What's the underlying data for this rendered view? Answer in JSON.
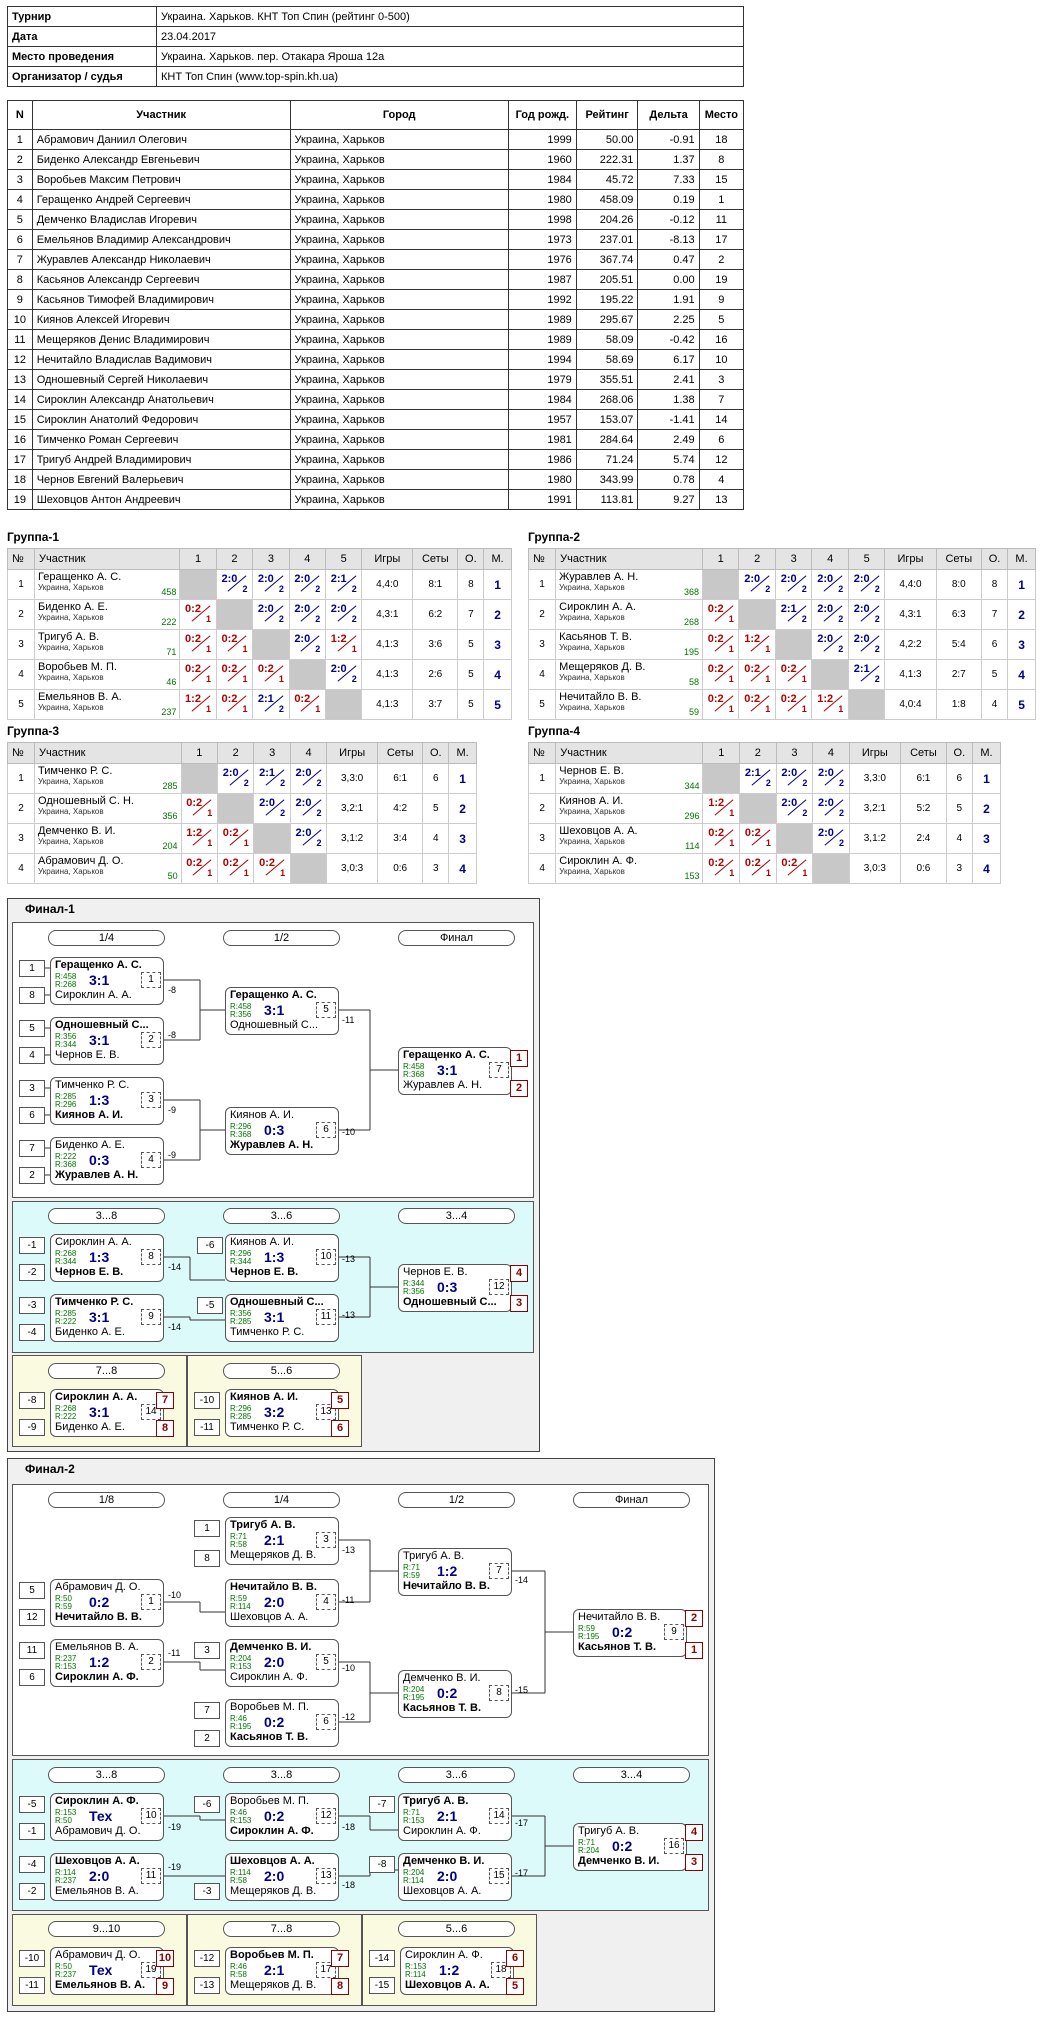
{
  "info": [
    {
      "k": "Турнир",
      "v": "Украина. Харьков. КНТ Топ Спин (рейтинг 0-500)"
    },
    {
      "k": "Дата",
      "v": "23.04.2017"
    },
    {
      "k": "Место проведения",
      "v": "Украина. Харьков. пер. Отакара Яроша 12а"
    },
    {
      "k": "Организатор / судья",
      "v": "КНТ Топ Спин (www.top-spin.kh.ua)"
    }
  ],
  "players_header": [
    "N",
    "Участник",
    "Город",
    "Год рожд.",
    "Рейтинг",
    "Дельта",
    "Место"
  ],
  "players": [
    [
      "1",
      "Абрамович Даниил Олегович",
      "Украина, Харьков",
      "1999",
      "50.00",
      "-0.91",
      "18"
    ],
    [
      "2",
      "Биденко Александр Евгеньевич",
      "Украина, Харьков",
      "1960",
      "222.31",
      "1.37",
      "8"
    ],
    [
      "3",
      "Воробьев Максим Петрович",
      "Украина, Харьков",
      "1984",
      "45.72",
      "7.33",
      "15"
    ],
    [
      "4",
      "Геращенко Андрей Сергеевич",
      "Украина, Харьков",
      "1980",
      "458.09",
      "0.19",
      "1"
    ],
    [
      "5",
      "Демченко Владислав Игоревич",
      "Украина, Харьков",
      "1998",
      "204.26",
      "-0.12",
      "11"
    ],
    [
      "6",
      "Емельянов Владимир Александрович",
      "Украина, Харьков",
      "1973",
      "237.01",
      "-8.13",
      "17"
    ],
    [
      "7",
      "Журавлев Александр Николаевич",
      "Украина, Харьков",
      "1976",
      "367.74",
      "0.47",
      "2"
    ],
    [
      "8",
      "Касьянов Александр Сергеевич",
      "Украина, Харьков",
      "1987",
      "205.51",
      "0.00",
      "19"
    ],
    [
      "9",
      "Касьянов Тимофей Владимирович",
      "Украина, Харьков",
      "1992",
      "195.22",
      "1.91",
      "9"
    ],
    [
      "10",
      "Киянов Алексей Игоревич",
      "Украина, Харьков",
      "1989",
      "295.67",
      "2.25",
      "5"
    ],
    [
      "11",
      "Мещеряков Денис Владимирович",
      "Украина, Харьков",
      "1989",
      "58.09",
      "-0.42",
      "16"
    ],
    [
      "12",
      "Нечитайло Владислав Вадимович",
      "Украина, Харьков",
      "1994",
      "58.69",
      "6.17",
      "10"
    ],
    [
      "13",
      "Одношевный Сергей Николаевич",
      "Украина, Харьков",
      "1979",
      "355.51",
      "2.41",
      "3"
    ],
    [
      "14",
      "Сироклин Александр Анатольевич",
      "Украина, Харьков",
      "1984",
      "268.06",
      "1.38",
      "7"
    ],
    [
      "15",
      "Сироклин Анатолий Федорович",
      "Украина, Харьков",
      "1957",
      "153.07",
      "-1.41",
      "14"
    ],
    [
      "16",
      "Тимченко Роман Сергеевич",
      "Украина, Харьков",
      "1981",
      "284.64",
      "2.49",
      "6"
    ],
    [
      "17",
      "Тригуб Андрей Владимирович",
      "Украина, Харьков",
      "1986",
      "71.24",
      "5.74",
      "12"
    ],
    [
      "18",
      "Чернов Евгений Валерьевич",
      "Украина, Харьков",
      "1980",
      "343.99",
      "0.78",
      "4"
    ],
    [
      "19",
      "Шеховцов Антон Андреевич",
      "Украина, Харьков",
      "1991",
      "113.81",
      "9.27",
      "13"
    ]
  ],
  "group_cols": {
    "no": "№",
    "player": "Участник",
    "games": "Игры",
    "sets": "Сеты",
    "pts": "О.",
    "place": "М."
  },
  "groups": [
    {
      "title": "Группа-1",
      "size": 5,
      "rows": [
        {
          "no": "1",
          "name": "Геращенко А. С.",
          "city": "Украина, Харьков",
          "rating": "458",
          "res": [
            "",
            "2:0/2",
            "2:0/2",
            "2:0/2",
            "2:1/2"
          ],
          "games": "4,4:0",
          "sets": "8:1",
          "pts": "8",
          "place": "1"
        },
        {
          "no": "2",
          "name": "Биденко А. Е.",
          "city": "Украина, Харьков",
          "rating": "222",
          "res": [
            "0:2/1",
            "",
            "2:0/2",
            "2:0/2",
            "2:0/2"
          ],
          "games": "4,3:1",
          "sets": "6:2",
          "pts": "7",
          "place": "2"
        },
        {
          "no": "3",
          "name": "Тригуб А. В.",
          "city": "Украина, Харьков",
          "rating": "71",
          "res": [
            "0:2/1",
            "0:2/1",
            "",
            "2:0/2",
            "1:2/1"
          ],
          "games": "4,1:3",
          "sets": "3:6",
          "pts": "5",
          "place": "3"
        },
        {
          "no": "4",
          "name": "Воробьев М. П.",
          "city": "Украина, Харьков",
          "rating": "46",
          "res": [
            "0:2/1",
            "0:2/1",
            "0:2/1",
            "",
            "2:0/2"
          ],
          "games": "4,1:3",
          "sets": "2:6",
          "pts": "5",
          "place": "4"
        },
        {
          "no": "5",
          "name": "Емельянов В. А.",
          "city": "Украина, Харьков",
          "rating": "237",
          "res": [
            "1:2/1",
            "0:2/1",
            "2:1/2",
            "0:2/1",
            ""
          ],
          "games": "4,1:3",
          "sets": "3:7",
          "pts": "5",
          "place": "5"
        }
      ]
    },
    {
      "title": "Группа-2",
      "size": 5,
      "rows": [
        {
          "no": "1",
          "name": "Журавлев А. Н.",
          "city": "Украина, Харьков",
          "rating": "368",
          "res": [
            "",
            "2:0/2",
            "2:0/2",
            "2:0/2",
            "2:0/2"
          ],
          "games": "4,4:0",
          "sets": "8:0",
          "pts": "8",
          "place": "1"
        },
        {
          "no": "2",
          "name": "Сироклин А. А.",
          "city": "Украина, Харьков",
          "rating": "268",
          "res": [
            "0:2/1",
            "",
            "2:1/2",
            "2:0/2",
            "2:0/2"
          ],
          "games": "4,3:1",
          "sets": "6:3",
          "pts": "7",
          "place": "2"
        },
        {
          "no": "3",
          "name": "Касьянов Т. В.",
          "city": "Украина, Харьков",
          "rating": "195",
          "res": [
            "0:2/1",
            "1:2/1",
            "",
            "2:0/2",
            "2:0/2"
          ],
          "games": "4,2:2",
          "sets": "5:4",
          "pts": "6",
          "place": "3"
        },
        {
          "no": "4",
          "name": "Мещеряков Д. В.",
          "city": "Украина, Харьков",
          "rating": "58",
          "res": [
            "0:2/1",
            "0:2/1",
            "0:2/1",
            "",
            "2:1/2"
          ],
          "games": "4,1:3",
          "sets": "2:7",
          "pts": "5",
          "place": "4"
        },
        {
          "no": "5",
          "name": "Нечитайло В. В.",
          "city": "Украина, Харьков",
          "rating": "59",
          "res": [
            "0:2/1",
            "0:2/1",
            "0:2/1",
            "1:2/1",
            ""
          ],
          "games": "4,0:4",
          "sets": "1:8",
          "pts": "4",
          "place": "5"
        }
      ]
    },
    {
      "title": "Группа-3",
      "size": 4,
      "rows": [
        {
          "no": "1",
          "name": "Тимченко Р. С.",
          "city": "Украина, Харьков",
          "rating": "285",
          "res": [
            "",
            "2:0/2",
            "2:1/2",
            "2:0/2"
          ],
          "games": "3,3:0",
          "sets": "6:1",
          "pts": "6",
          "place": "1"
        },
        {
          "no": "2",
          "name": "Одношевный С. Н.",
          "city": "Украина, Харьков",
          "rating": "356",
          "res": [
            "0:2/1",
            "",
            "2:0/2",
            "2:0/2"
          ],
          "games": "3,2:1",
          "sets": "4:2",
          "pts": "5",
          "place": "2"
        },
        {
          "no": "3",
          "name": "Демченко В. И.",
          "city": "Украина, Харьков",
          "rating": "204",
          "res": [
            "1:2/1",
            "0:2/1",
            "",
            "2:0/2"
          ],
          "games": "3,1:2",
          "sets": "3:4",
          "pts": "4",
          "place": "3"
        },
        {
          "no": "4",
          "name": "Абрамович Д. О.",
          "city": "Украина, Харьков",
          "rating": "50",
          "res": [
            "0:2/1",
            "0:2/1",
            "0:2/1",
            ""
          ],
          "games": "3,0:3",
          "sets": "0:6",
          "pts": "3",
          "place": "4"
        }
      ]
    },
    {
      "title": "Группа-4",
      "size": 4,
      "rows": [
        {
          "no": "1",
          "name": "Чернов Е. В.",
          "city": "Украина, Харьков",
          "rating": "344",
          "res": [
            "",
            "2:1/2",
            "2:0/2",
            "2:0/2"
          ],
          "games": "3,3:0",
          "sets": "6:1",
          "pts": "6",
          "place": "1"
        },
        {
          "no": "2",
          "name": "Киянов А. И.",
          "city": "Украина, Харьков",
          "rating": "296",
          "res": [
            "1:2/1",
            "",
            "2:0/2",
            "2:0/2"
          ],
          "games": "3,2:1",
          "sets": "5:2",
          "pts": "5",
          "place": "2"
        },
        {
          "no": "3",
          "name": "Шеховцов А. А.",
          "city": "Украина, Харьков",
          "rating": "114",
          "res": [
            "0:2/1",
            "0:2/1",
            "",
            "2:0/2"
          ],
          "games": "3,1:2",
          "sets": "2:4",
          "pts": "4",
          "place": "3"
        },
        {
          "no": "4",
          "name": "Сироклин А. Ф.",
          "city": "Украина, Харьков",
          "rating": "153",
          "res": [
            "0:2/1",
            "0:2/1",
            "0:2/1",
            ""
          ],
          "games": "3,0:3",
          "sets": "0:6",
          "pts": "3",
          "place": "4"
        }
      ]
    }
  ],
  "finals": {
    "f1_title": "Финал-1",
    "f2_title": "Финал-2",
    "headers": {
      "q": "1/4",
      "s": "1/2",
      "f": "Финал",
      "r38": "3...8",
      "r36": "3...6",
      "r34": "3...4",
      "r78": "7...8",
      "r56": "5...6",
      "e": "1/8",
      "r910": "9...10"
    },
    "matches": {
      "m1": {
        "p1": "Геращенко А. С.",
        "r1": "R:458",
        "r2": "R:268",
        "p2": "Сироклин А. А.",
        "score": "3:1",
        "num": "1",
        "w": 1
      },
      "m2": {
        "p1": "Одношевный С...",
        "r1": "R:356",
        "r2": "R:344",
        "p2": "Чернов Е. В.",
        "score": "3:1",
        "num": "2",
        "w": 1
      },
      "m3": {
        "p1": "Тимченко Р. С.",
        "r1": "R:285",
        "r2": "R:296",
        "p2": "Киянов А. И.",
        "score": "1:3",
        "num": "3",
        "w": 2
      },
      "m4": {
        "p1": "Биденко А. Е.",
        "r1": "R:222",
        "r2": "R:368",
        "p2": "Журавлев А. Н.",
        "score": "0:3",
        "num": "4",
        "w": 2
      },
      "m5": {
        "p1": "Геращенко А. С.",
        "r1": "R:458",
        "r2": "R:356",
        "p2": "Одношевный С...",
        "score": "3:1",
        "num": "5",
        "w": 1
      },
      "m6": {
        "p1": "Киянов А. И.",
        "r1": "R:296",
        "r2": "R:368",
        "p2": "Журавлев А. Н.",
        "score": "0:3",
        "num": "6",
        "w": 2
      },
      "m7": {
        "p1": "Геращенко А. С.",
        "r1": "R:458",
        "r2": "R:368",
        "p2": "Журавлев А. Н.",
        "score": "3:1",
        "num": "7",
        "w": 1
      },
      "m8": {
        "p1": "Сироклин А. А.",
        "r1": "R:268",
        "r2": "R:344",
        "p2": "Чернов Е. В.",
        "score": "1:3",
        "num": "8",
        "w": 2
      },
      "m9": {
        "p1": "Тимченко Р. С.",
        "r1": "R:285",
        "r2": "R:222",
        "p2": "Биденко А. Е.",
        "score": "3:1",
        "num": "9",
        "w": 1
      },
      "m10": {
        "p1": "Киянов А. И.",
        "r1": "R:296",
        "r2": "R:344",
        "p2": "Чернов Е. В.",
        "score": "1:3",
        "num": "10",
        "w": 2
      },
      "m11": {
        "p1": "Одношевный С...",
        "r1": "R:356",
        "r2": "R:285",
        "p2": "Тимченко Р. С.",
        "score": "3:1",
        "num": "11",
        "w": 1
      },
      "m12": {
        "p1": "Чернов Е. В.",
        "r1": "R:344",
        "r2": "R:356",
        "p2": "Одношевный С...",
        "score": "0:3",
        "num": "12",
        "w": 2
      },
      "m14": {
        "p1": "Сироклин А. А.",
        "r1": "R:268",
        "r2": "R:222",
        "p2": "Биденко А. Е.",
        "score": "3:1",
        "num": "14",
        "w": 1
      },
      "m13": {
        "p1": "Киянов А. И.",
        "r1": "R:296",
        "r2": "R:285",
        "p2": "Тимченко Р. С.",
        "score": "3:2",
        "num": "13",
        "w": 1
      },
      "n1": {
        "p1": "Абрамович Д. О.",
        "r1": "R:50",
        "r2": "R:59",
        "p2": "Нечитайло В. В.",
        "score": "0:2",
        "num": "1",
        "w": 2
      },
      "n2": {
        "p1": "Емельянов В. А.",
        "r1": "R:237",
        "r2": "R:153",
        "p2": "Сироклин А. Ф.",
        "score": "1:2",
        "num": "2",
        "w": 2
      },
      "n3": {
        "p1": "Тригуб А. В.",
        "r1": "R:71",
        "r2": "R:58",
        "p2": "Мещеряков Д. В.",
        "score": "2:1",
        "num": "3",
        "w": 1
      },
      "n4": {
        "p1": "Нечитайло В. В.",
        "r1": "R:59",
        "r2": "R:114",
        "p2": "Шеховцов А. А.",
        "score": "2:0",
        "num": "4",
        "w": 1
      },
      "n5": {
        "p1": "Демченко В. И.",
        "r1": "R:204",
        "r2": "R:153",
        "p2": "Сироклин А. Ф.",
        "score": "2:0",
        "num": "5",
        "w": 1
      },
      "n6": {
        "p1": "Воробьев М. П.",
        "r1": "R:46",
        "r2": "R:195",
        "p2": "Касьянов Т. В.",
        "score": "0:2",
        "num": "6",
        "w": 2
      },
      "n7": {
        "p1": "Тригуб А. В.",
        "r1": "R:71",
        "r2": "R:59",
        "p2": "Нечитайло В. В.",
        "score": "1:2",
        "num": "7",
        "w": 2
      },
      "n8": {
        "p1": "Демченко В. И.",
        "r1": "R:204",
        "r2": "R:195",
        "p2": "Касьянов Т. В.",
        "score": "0:2",
        "num": "8",
        "w": 2
      },
      "n9": {
        "p1": "Нечитайло В. В.",
        "r1": "R:59",
        "r2": "R:195",
        "p2": "Касьянов Т. В.",
        "score": "0:2",
        "num": "9",
        "w": 2
      },
      "n10": {
        "p1": "Сироклин А. Ф.",
        "r1": "R:153",
        "r2": "R:50",
        "p2": "Абрамович Д. О.",
        "score": "Тех",
        "num": "10",
        "w": 1
      },
      "n11": {
        "p1": "Шеховцов А. А.",
        "r1": "R:114",
        "r2": "R:237",
        "p2": "Емельянов В. А.",
        "score": "2:0",
        "num": "11",
        "w": 1
      },
      "n12": {
        "p1": "Воробьев М. П.",
        "r1": "R:46",
        "r2": "R:153",
        "p2": "Сироклин А. Ф.",
        "score": "0:2",
        "num": "12",
        "w": 2
      },
      "n13": {
        "p1": "Шеховцов А. А.",
        "r1": "R:114",
        "r2": "R:58",
        "p2": "Мещеряков Д. В.",
        "score": "2:0",
        "num": "13",
        "w": 1
      },
      "n14": {
        "p1": "Тригуб А. В.",
        "r1": "R:71",
        "r2": "R:153",
        "p2": "Сироклин А. Ф.",
        "score": "2:1",
        "num": "14",
        "w": 1
      },
      "n15": {
        "p1": "Демченко В. И.",
        "r1": "R:204",
        "r2": "R:114",
        "p2": "Шеховцов А. А.",
        "score": "2:0",
        "num": "15",
        "w": 1
      },
      "n16": {
        "p1": "Тригуб А. В.",
        "r1": "R:71",
        "r2": "R:204",
        "p2": "Демченко В. И.",
        "score": "0:2",
        "num": "16",
        "w": 2
      },
      "n17": {
        "p1": "Воробьев М. П.",
        "r1": "R:46",
        "r2": "R:58",
        "p2": "Мещеряков Д. В.",
        "score": "2:1",
        "num": "17",
        "w": 1
      },
      "n18": {
        "p1": "Сироклин А. Ф.",
        "r1": "R:153",
        "r2": "R:114",
        "p2": "Шеховцов А. А.",
        "score": "1:2",
        "num": "18",
        "w": 2
      },
      "n19": {
        "p1": "Абрамович Д. О.",
        "r1": "R:50",
        "r2": "R:237",
        "p2": "Емельянов В. А.",
        "score": "Тех",
        "num": "19",
        "w": 2
      }
    }
  }
}
